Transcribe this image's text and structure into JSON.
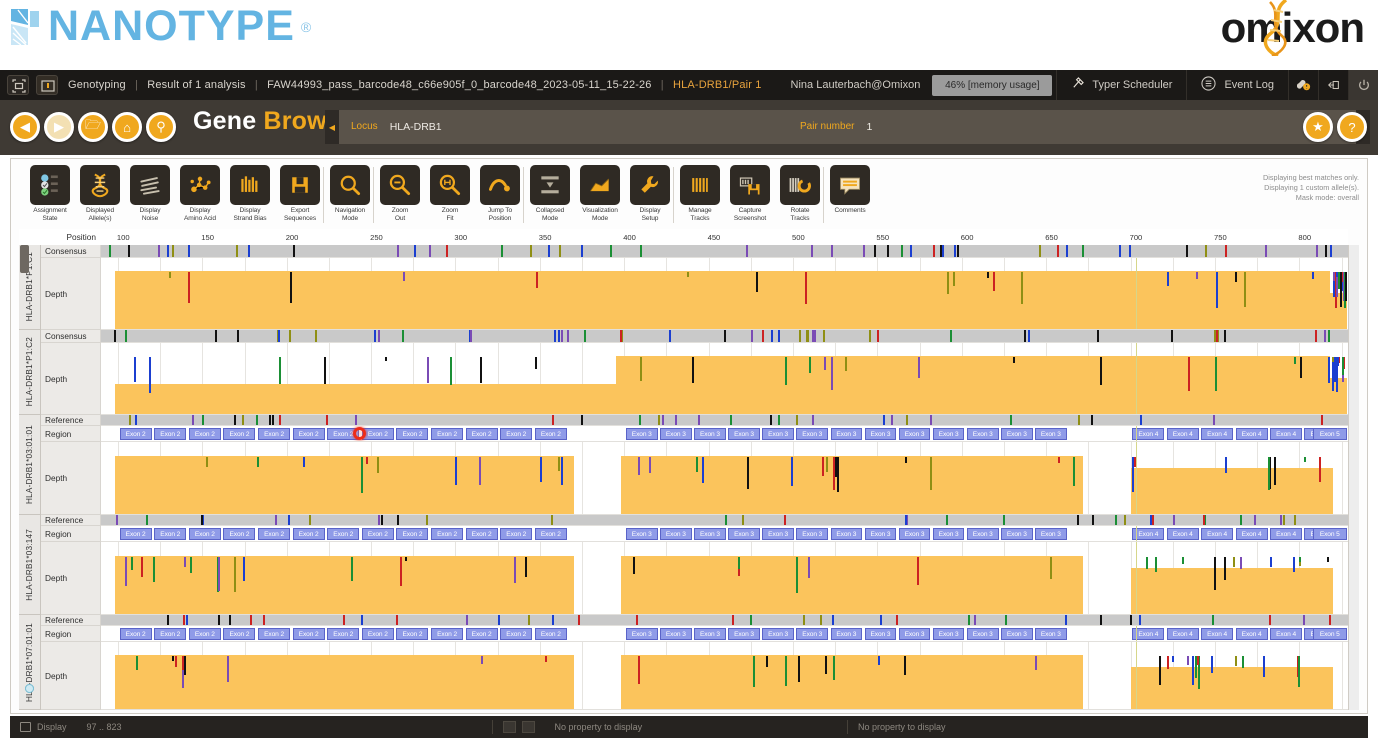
{
  "brand": {
    "left_logo_text": "NANOTYPE",
    "left_logo_reg": "®",
    "right_logo_text": "omixon"
  },
  "topbar": {
    "icons": [
      {
        "name": "fullscreen-icon",
        "glyph": "⛶"
      },
      {
        "name": "window-icon",
        "glyph": "⬜"
      }
    ],
    "breadcrumb": {
      "module": "Genotyping",
      "analysis": "Result of 1 analysis",
      "sample": "FAW44993_pass_barcode48_c66e905f_0_barcode48_2023-05-11_15-22-26",
      "current": "HLA-DRB1/Pair 1"
    },
    "user": "Nina Lauterbach@Omixon",
    "memory": "46% [memory usage]",
    "typer_scheduler": "Typer Scheduler",
    "event_log": "Event Log",
    "right_icons": [
      {
        "name": "notifications-icon",
        "glyph": "🔔"
      },
      {
        "name": "logout-icon",
        "glyph": "↤"
      },
      {
        "name": "power-icon",
        "glyph": "⏻"
      }
    ]
  },
  "titleband": {
    "nav_buttons": [
      {
        "name": "back-button",
        "glyph": "◀",
        "dim": false
      },
      {
        "name": "forward-button",
        "glyph": "▶",
        "dim": true
      },
      {
        "name": "open-folder-button",
        "glyph": "🗁",
        "dim": false
      },
      {
        "name": "home-button",
        "glyph": "⌂",
        "dim": false
      },
      {
        "name": "search-button",
        "glyph": "⚲",
        "dim": false
      }
    ],
    "title_a": "Gene ",
    "title_b": "Browser",
    "locus_label": "Locus",
    "locus_value": "HLA-DRB1",
    "pair_label": "Pair number",
    "pair_value": "1",
    "favorite_button": {
      "name": "favorite-button",
      "glyph": "★"
    },
    "help_button": {
      "name": "help-button",
      "glyph": "?"
    }
  },
  "toolbar": {
    "tools": [
      {
        "name": "assignment-state-tool",
        "line1": "Assignment",
        "line2": "State",
        "icon": "assignment-state-icon",
        "sep": false
      },
      {
        "name": "displayed-alleles-tool",
        "line1": "Displayed",
        "line2": "Allele(s)",
        "icon": "dna-icon",
        "sep": false
      },
      {
        "name": "display-noise-tool",
        "line1": "Display",
        "line2": "Noise",
        "icon": "noise-icon",
        "sep": false
      },
      {
        "name": "display-amino-acid-tool",
        "line1": "Display",
        "line2": "Amino Acid",
        "icon": "molecule-icon",
        "sep": false
      },
      {
        "name": "display-strand-bias-tool",
        "line1": "Display",
        "line2": "Strand Bias",
        "icon": "bars-icon",
        "sep": false
      },
      {
        "name": "export-sequences-tool",
        "line1": "Export",
        "line2": "Sequences",
        "icon": "save-icon",
        "sep": false
      },
      {
        "name": "navigation-mode-tool",
        "line1": "Navigation",
        "line2": "Mode",
        "icon": "magnifier-icon",
        "sep": true
      },
      {
        "name": "zoom-out-tool",
        "line1": "Zoom",
        "line2": "Out",
        "icon": "zoom-out-icon",
        "sep": true
      },
      {
        "name": "zoom-fit-tool",
        "line1": "Zoom",
        "line2": "Fit",
        "icon": "zoom-fit-icon",
        "sep": false
      },
      {
        "name": "jump-to-position-tool",
        "line1": "Jump To",
        "line2": "Position",
        "icon": "jump-icon",
        "sep": false
      },
      {
        "name": "collapsed-mode-tool",
        "line1": "Collapsed",
        "line2": "Mode",
        "icon": "collapse-icon",
        "sep": true
      },
      {
        "name": "visualization-mode-tool",
        "line1": "Visualization",
        "line2": "Mode",
        "icon": "visualization-icon",
        "sep": false
      },
      {
        "name": "display-setup-tool",
        "line1": "Display",
        "line2": "Setup",
        "icon": "wrench-icon",
        "sep": false
      },
      {
        "name": "manage-tracks-tool",
        "line1": "Manage",
        "line2": "Tracks",
        "icon": "tracks-icon",
        "sep": true
      },
      {
        "name": "capture-screenshot-tool",
        "line1": "Capture",
        "line2": "Screenshot",
        "icon": "camera-save-icon",
        "sep": false
      },
      {
        "name": "rotate-tracks-tool",
        "line1": "Rotate",
        "line2": "Tracks",
        "icon": "rotate-icon",
        "sep": false
      },
      {
        "name": "comments-tool",
        "line1": "Comments",
        "line2": "",
        "icon": "comment-icon",
        "sep": true
      }
    ],
    "info_lines": [
      "Displaying best matches only.",
      "Displaying 1 custom allele(s).",
      "Mask mode: overall"
    ]
  },
  "browser": {
    "position_label": "Position",
    "consensus_label": "Consensus",
    "depth_label": "Depth",
    "reference_label": "Reference",
    "region_label": "Region",
    "ruler": {
      "ticks": [
        100,
        150,
        200,
        250,
        300,
        350,
        400,
        450,
        500,
        550,
        600,
        650,
        700,
        750,
        800
      ],
      "start": 97,
      "end": 823
    },
    "exon_labels": {
      "exon2": "Exon 2",
      "exon3": "Exon 3",
      "exon4": "Exon 4",
      "exon5": "Exon 5"
    },
    "lanes": [
      {
        "name": "HLA-DRB1*P1:C1",
        "type": "consensus",
        "marker": false
      },
      {
        "name": "HLA-DRB1*P1:C2",
        "type": "consensus",
        "marker": false
      },
      {
        "name": "HLA-DRB1*03:01:01",
        "type": "allele",
        "marker": true
      },
      {
        "name": "HLA-DRB1*03:147",
        "type": "allele",
        "marker": true
      },
      {
        "name": "HLA-DRB1*07:01:01",
        "type": "allele",
        "marker": true
      }
    ]
  },
  "statusbar": {
    "display_label": "Display",
    "range": "97 .. 823",
    "no_property_left": "No property to display",
    "no_property_right": "No property to display"
  },
  "colors": {
    "accent": "#f0a81e",
    "coverage": "#fbc45c",
    "exon": "#8f9be8",
    "cursor": "#ee2b18",
    "highlight": "#e8a33d"
  }
}
